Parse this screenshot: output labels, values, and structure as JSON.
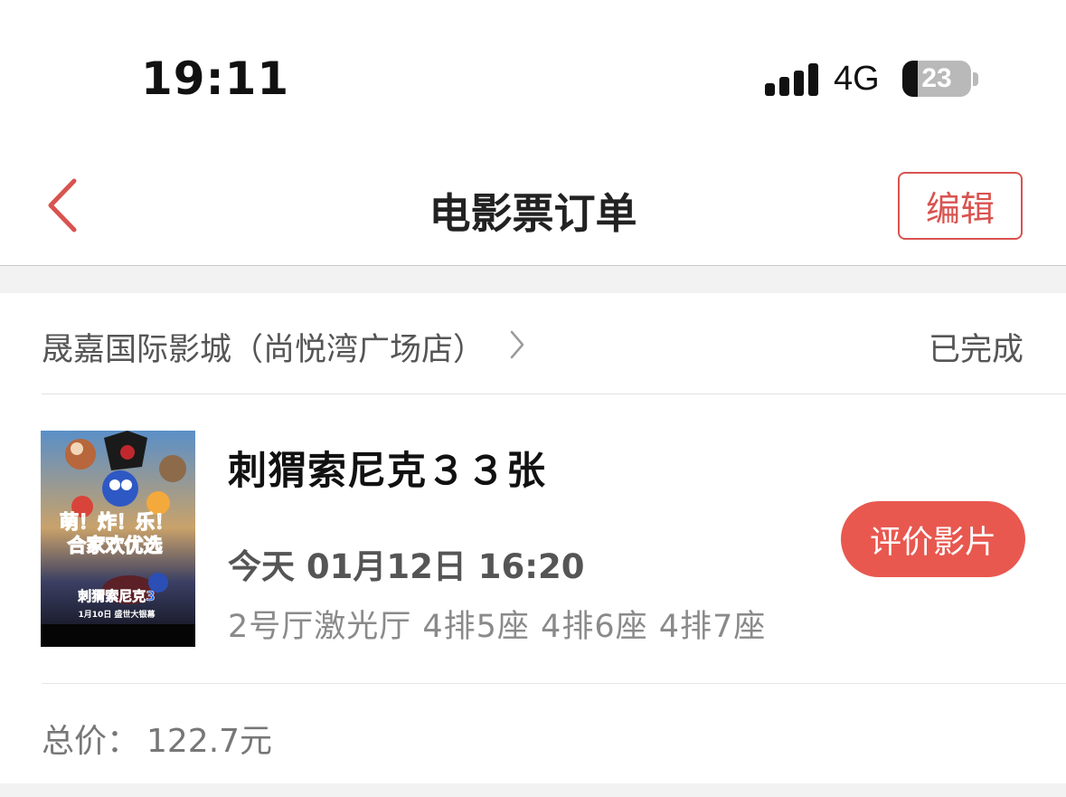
{
  "status_bar": {
    "time": "19:11",
    "network": "4G",
    "battery_level": 23,
    "battery_text": "23"
  },
  "nav": {
    "title": "电影票订单",
    "edit_label": "编辑",
    "back_icon": "chevron-left-icon"
  },
  "order": {
    "cinema_name": "晟嘉国际影城（尚悦湾广场店）",
    "status": "已完成",
    "movie_title": "刺猬索尼克３３张",
    "show_time": "今天 01月12日 16:20",
    "seat_info": "2号厅激光厅 4排5座 4排6座 4排7座",
    "review_label": "评价影片",
    "total_label": "总价：",
    "total_value": "122.7元",
    "poster": {
      "tagline_1": "萌！炸！乐！",
      "tagline_2": "合家欢优选",
      "logo_text": "刺猬索尼克3",
      "release_text": "1月10日 盛世大银幕"
    }
  },
  "colors": {
    "accent": "#e8584f",
    "edit_border": "#d9534f",
    "background": "#f2f2f2"
  }
}
